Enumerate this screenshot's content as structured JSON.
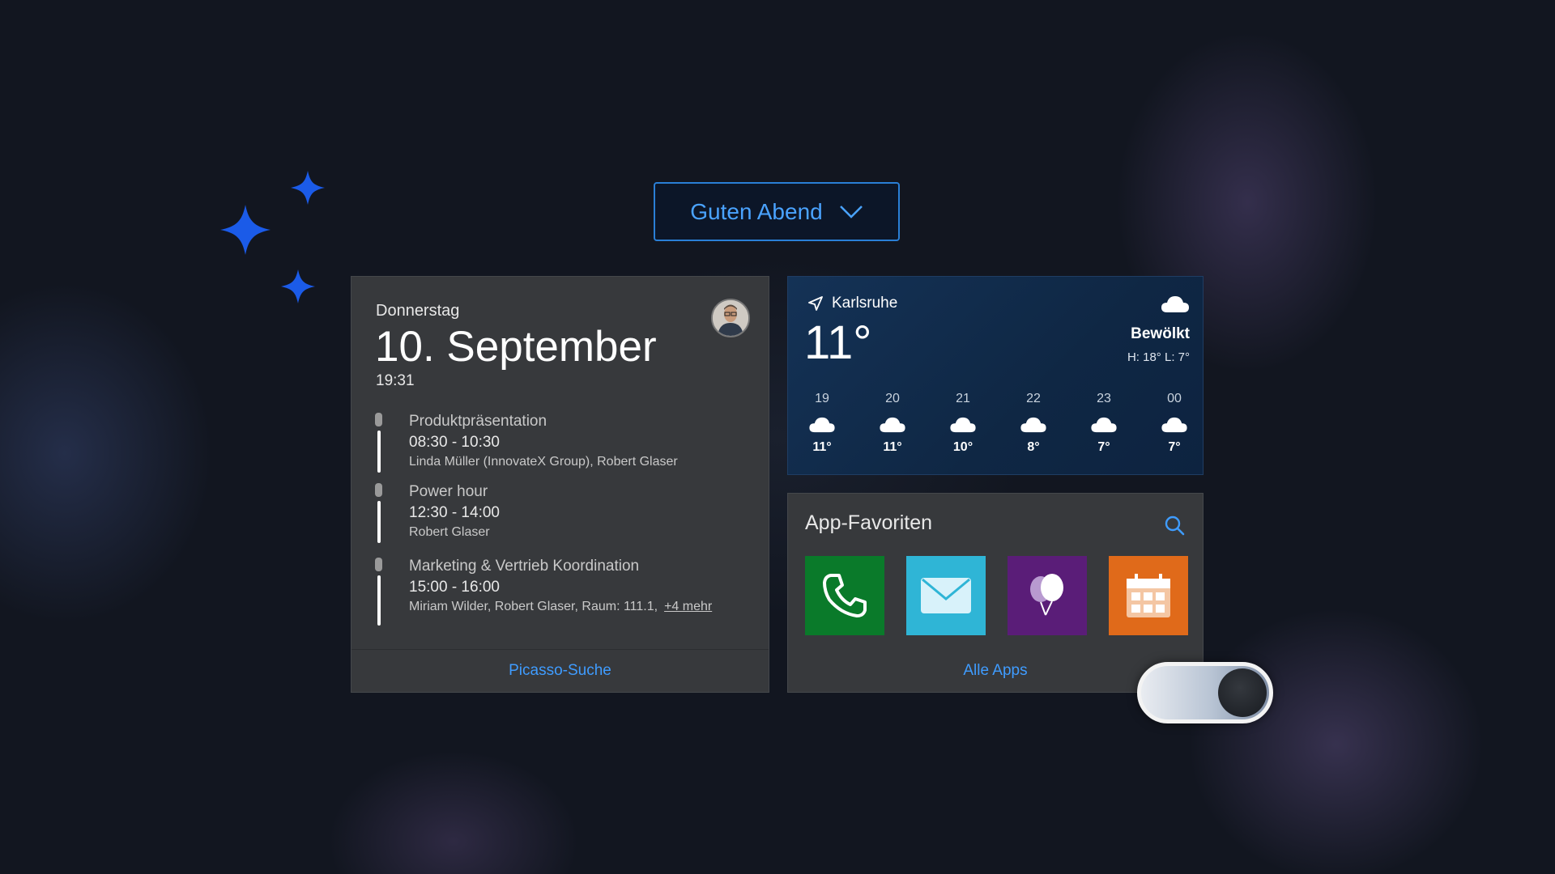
{
  "greeting": {
    "label": "Guten Abend",
    "icon": "chevron-down-icon",
    "accent": "#4aa3ff"
  },
  "calendar": {
    "weekday": "Donnerstag",
    "date": "10. September",
    "time": "19:31",
    "events": [
      {
        "title": "Produktpräsentation",
        "time": "08:30 - 10:30",
        "people": "Linda Müller (InnovateX Group), Robert Glaser"
      },
      {
        "title": "Power hour",
        "time": "12:30 - 14:00",
        "people": "Robert Glaser"
      },
      {
        "title": "Marketing & Vertrieb Koordination",
        "time": "15:00 - 16:00",
        "people": "Miriam Wilder, Robert Glaser, Raum: 111.1,",
        "more": "+4 mehr"
      }
    ],
    "footer_link": "Picasso-Suche"
  },
  "weather": {
    "location": "Karlsruhe",
    "temperature": "11°",
    "condition": "Bewölkt",
    "high_low": "H: 18° L: 7°",
    "icon": "cloud-icon",
    "hourly": [
      {
        "hour": "19",
        "temp": "11°"
      },
      {
        "hour": "20",
        "temp": "11°"
      },
      {
        "hour": "21",
        "temp": "10°"
      },
      {
        "hour": "22",
        "temp": "8°"
      },
      {
        "hour": "23",
        "temp": "7°"
      },
      {
        "hour": "00",
        "temp": "7°"
      }
    ]
  },
  "apps": {
    "title": "App-Favoriten",
    "tiles": [
      {
        "name": "phone-app",
        "icon": "phone-icon",
        "color": "#0a7a2a"
      },
      {
        "name": "mail-app",
        "icon": "envelope-icon",
        "color": "#2fb5d6"
      },
      {
        "name": "balloon-app",
        "icon": "balloon-icon",
        "color": "#5a1d78"
      },
      {
        "name": "calendar-app",
        "icon": "calendar-grid-icon",
        "color": "#e06a1a"
      }
    ],
    "footer_link": "Alle Apps"
  },
  "toggle": {
    "state": "on"
  }
}
